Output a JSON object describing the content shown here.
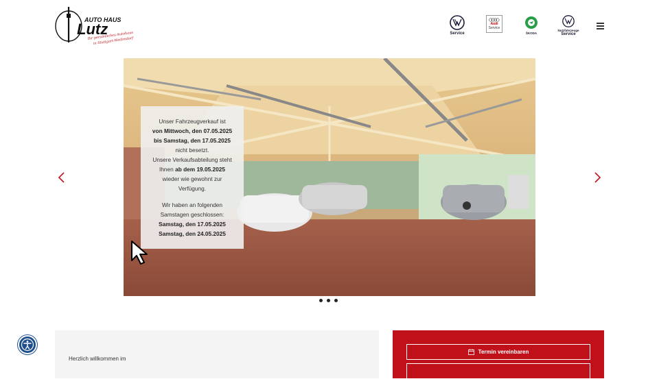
{
  "header": {
    "logo": {
      "brand_top": "AUTO HAUS",
      "brand_name": "Lutz",
      "tagline_1": "Ihr persönliches Autohaus",
      "tagline_2": "in Stuttgart-Weilimdorf"
    },
    "brands": [
      {
        "name": "Volkswagen",
        "label": "Service",
        "icon": "vw-logo-icon"
      },
      {
        "name": "Audi",
        "label_1": "Audi",
        "label_2": "Service",
        "icon": "audi-rings-icon"
      },
      {
        "name": "Skoda",
        "label": "ŠKODA",
        "icon": "skoda-logo-icon"
      },
      {
        "name": "Volkswagen Nutzfahrzeuge",
        "label_1": "Nutzfahrzeuge",
        "label_2": "Service",
        "icon": "vw-logo-icon"
      }
    ],
    "menu_icon": "hamburger-menu-icon"
  },
  "slider": {
    "notice": {
      "line1": "Unser Fahrzeugverkauf ist",
      "line2": "von Mittwoch, den 07.05.2025",
      "line3": "bis Samstag, den 17.05.2025",
      "line4": "nicht besetzt.",
      "line5": "Unsere Verkaufsabteilung steht",
      "line6_pre": "Ihnen ",
      "line6_bold": "ab dem 19.05.2025",
      "line7": "wieder wie gewohnt zur",
      "line8": "Verfügung.",
      "line9": "Wir haben an folgenden",
      "line10": "Samstagen geschlossen:",
      "line11": "Samstag, den 17.05.2025",
      "line12": "Samstag, den 24.05.2025"
    },
    "prev_icon": "chevron-left-icon",
    "next_icon": "chevron-right-icon",
    "slide_count": 3,
    "active_slide": 1
  },
  "welcome": {
    "intro": "Herzlich willkommen im"
  },
  "cta": {
    "appointment_label": "Termin vereinbaren"
  },
  "colors": {
    "brand_red": "#c0111a",
    "accessibility_blue": "#1e4f8c"
  }
}
